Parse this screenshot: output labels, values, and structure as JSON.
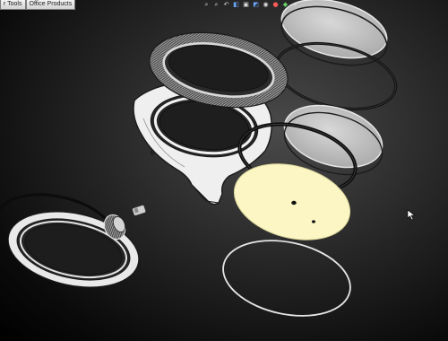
{
  "tabs": [
    {
      "label": "r Tools"
    },
    {
      "label": "Office Products"
    }
  ],
  "view_toolbar": {
    "icons": [
      "zoom-to-fit-icon",
      "zoom-area-icon",
      "previous-view-icon",
      "section-view-icon",
      "view-orientation-icon",
      "display-style-icon",
      "hide-show-icon",
      "edit-appearance-icon",
      "apply-scene-icon",
      "view-settings-icon"
    ]
  },
  "model": {
    "name": "watch-exploded-assembly",
    "parts": [
      "sapphire-crystal",
      "crystal-gasket",
      "knurled-bezel",
      "case-body",
      "inner-crystal",
      "case-gasket",
      "dial",
      "dial-ring",
      "back-gasket",
      "case-back",
      "crown-tube",
      "crown"
    ],
    "colors": {
      "dial": "#fbf6c4",
      "glass": "#c7c7c7",
      "metal": "#d9d9d9",
      "gasket": "#111111",
      "background": "#262626"
    }
  }
}
